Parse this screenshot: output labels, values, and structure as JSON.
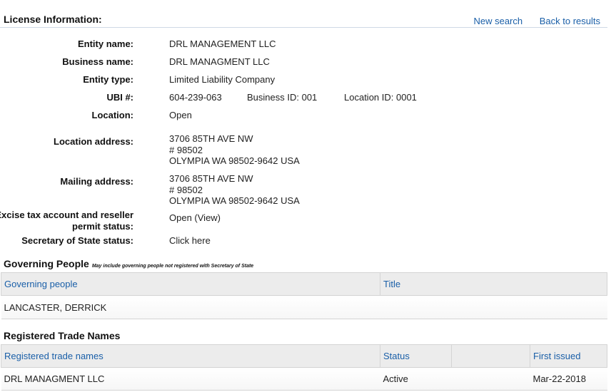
{
  "license": {
    "title": "License Information:",
    "links": {
      "new_search": "New search",
      "back_to_results": "Back to results"
    },
    "labels": {
      "entity_name": "Entity name:",
      "business_name": "Business name:",
      "entity_type": "Entity type:",
      "ubi": "UBI #:",
      "location": "Location:",
      "location_address": "Location address:",
      "mailing_address": "Mailing address:",
      "excise_line1": "Excise tax account and reseller",
      "excise_line2": "permit status:",
      "sos_status": "Secretary of State status:"
    },
    "values": {
      "entity_name": "DRL MANAGEMENT LLC",
      "business_name": "DRL MANAGMENT LLC",
      "entity_type": "Limited Liability Company",
      "ubi": "604-239-063",
      "business_id": "Business ID: 001",
      "location_id": "Location ID: 0001",
      "location": "Open",
      "location_address": {
        "line1": "3706 85TH AVE NW",
        "line2": "# 98502",
        "line3": "OLYMPIA WA 98502-9642 USA"
      },
      "mailing_address": {
        "line1": "3706 85TH AVE NW",
        "line2": "# 98502",
        "line3": "OLYMPIA WA 98502-9642 USA"
      },
      "excise_status": "Open (View)",
      "sos_status": "Click here"
    }
  },
  "governing": {
    "title": "Governing People",
    "note": "May include governing people not registered with Secretary of State",
    "columns": [
      "Governing people",
      "Title"
    ],
    "rows": [
      {
        "name": "LANCASTER, DERRICK",
        "title": ""
      }
    ]
  },
  "trade_names": {
    "title": "Registered Trade Names",
    "columns": [
      "Registered trade names",
      "Status",
      "",
      "First issued"
    ],
    "rows": [
      {
        "name": "DRL MANAGMENT LLC",
        "status": "Active",
        "blank": "",
        "first_issued": "Mar-22-2018"
      }
    ]
  },
  "colors": {
    "link": "#1a5fa8",
    "header_bg": "#ececec",
    "border": "#d4d4d4"
  }
}
